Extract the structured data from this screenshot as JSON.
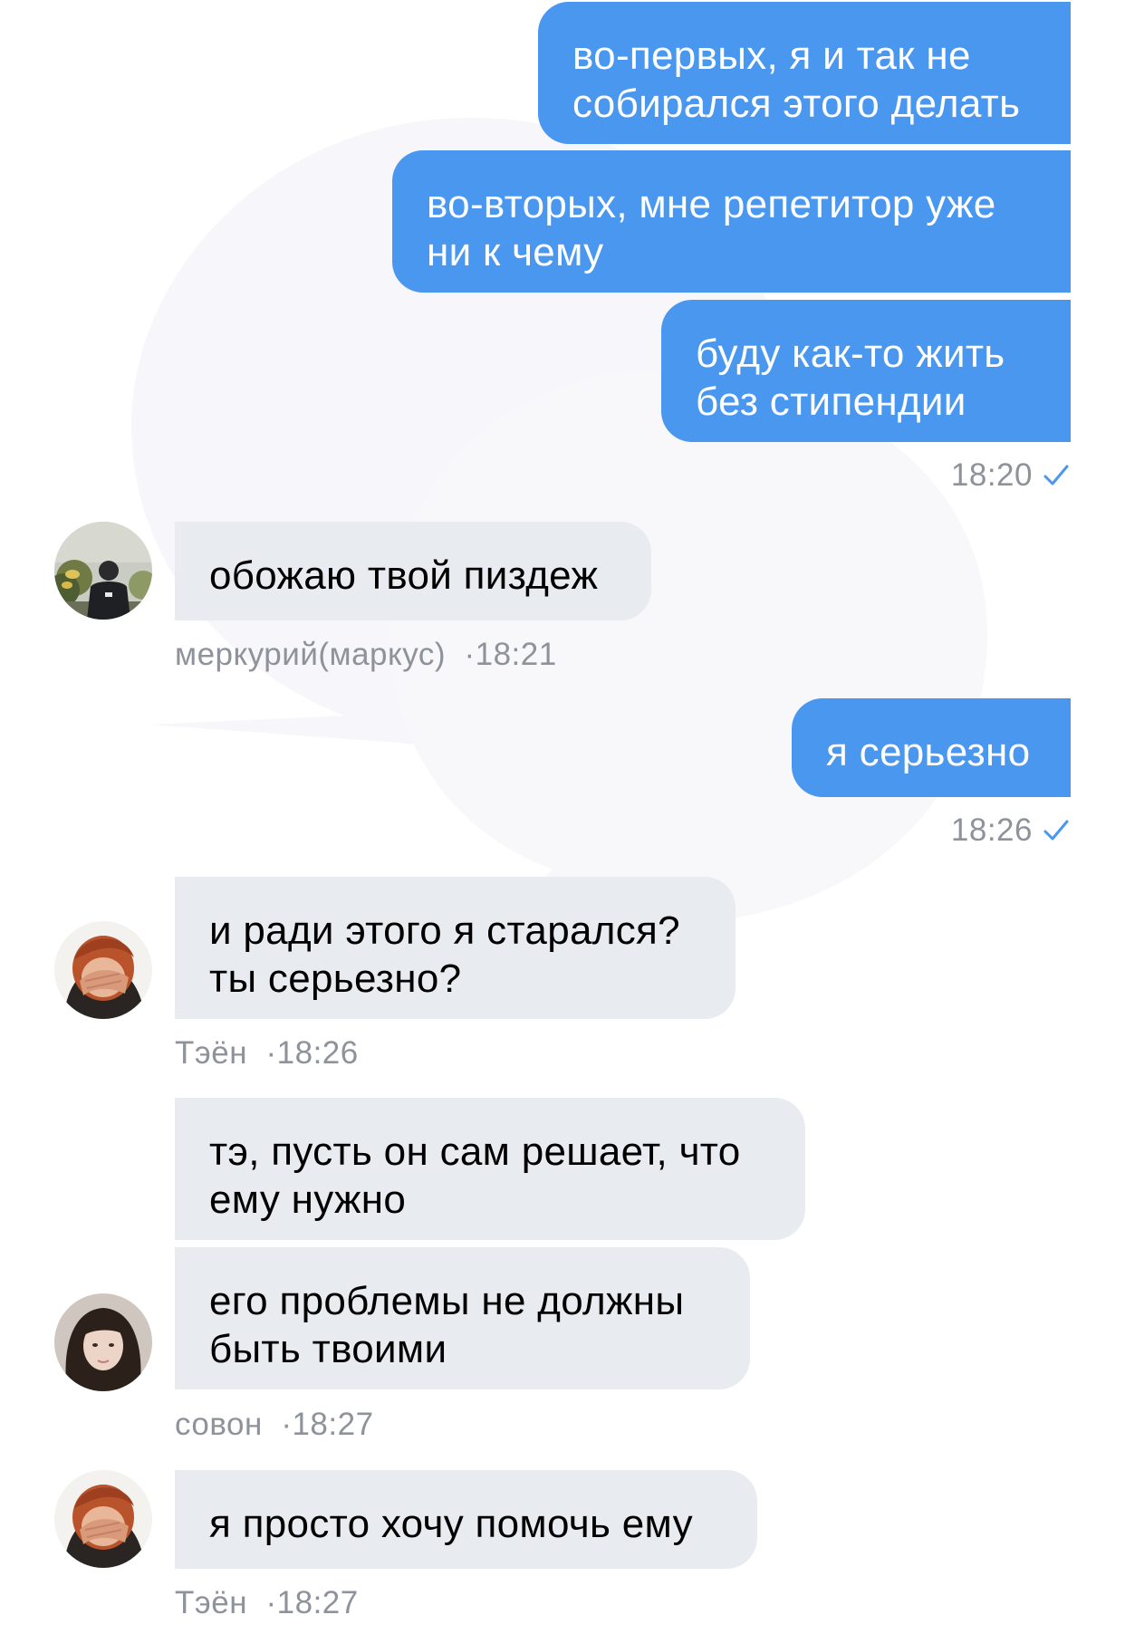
{
  "messages": [
    {
      "id": "m1",
      "direction": "outgoing",
      "text": "во-первых, я и так не\nсобирался этого делать"
    },
    {
      "id": "m2",
      "direction": "outgoing",
      "text": "во-вторых, мне репетитор уже\nни к чему"
    },
    {
      "id": "m3",
      "direction": "outgoing",
      "text": "буду как-то жить\nбез стипендии",
      "time": "18:20",
      "status": "read-check"
    },
    {
      "id": "m4",
      "direction": "incoming",
      "text": "обожаю твой пиздеж",
      "sender": "меркурий(маркус)",
      "time": "18:21"
    },
    {
      "id": "m5",
      "direction": "outgoing",
      "text": "я серьезно",
      "time": "18:26",
      "status": "read-check"
    },
    {
      "id": "m6",
      "direction": "incoming",
      "text": "и ради этого я старался?\nты серьезно?",
      "sender": "Тэён",
      "time": "18:26"
    },
    {
      "id": "m7",
      "direction": "incoming",
      "text": "тэ, пусть он сам решает, что\nему нужно"
    },
    {
      "id": "m8",
      "direction": "incoming",
      "text": "его проблемы не должны\nбыть твоими",
      "sender": "совон",
      "time": "18:27"
    },
    {
      "id": "m9",
      "direction": "incoming",
      "text": "я просто хочу помочь ему",
      "sender": "Тэён",
      "time": "18:27"
    }
  ],
  "meta_separator": "·",
  "icons": {
    "read_status": "check-icon",
    "avatar": "avatar-photo"
  },
  "colors": {
    "outgoing_bubble": "#4a97f0",
    "incoming_bubble": "#e8ebf0",
    "check": "#4a97f0",
    "meta_text": "#8e929a"
  }
}
